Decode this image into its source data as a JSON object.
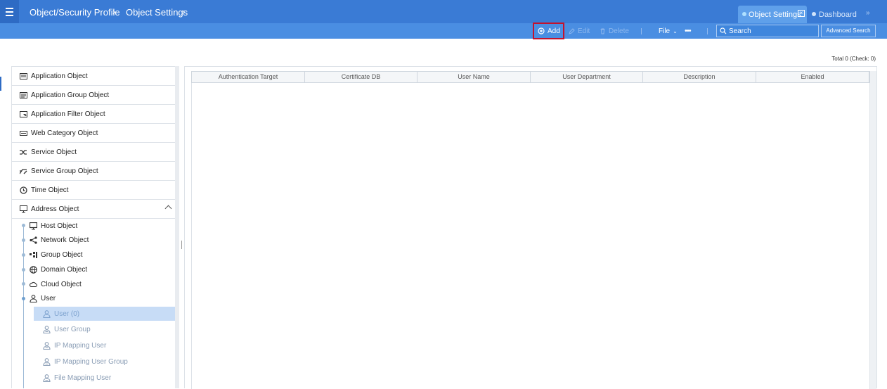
{
  "header": {
    "breadcrumb": [
      "Object/Security Profile",
      "Object Settings"
    ],
    "tabs": [
      {
        "label": "Object Settings",
        "active": true
      },
      {
        "label": "Dashboard",
        "active": false
      }
    ],
    "colors": {
      "header_bg": "#3a7bd5",
      "toolbar_bg": "#4a8ee2",
      "highlight_border": "#c4122d"
    }
  },
  "toolbar": {
    "add": "Add",
    "edit": "Edit",
    "delete": "Delete",
    "file": "File",
    "more": "•••",
    "search_placeholder": "Search",
    "advanced_search": "Advanced Search"
  },
  "summary": {
    "total": "Total 0 (Check: 0)"
  },
  "sidebar": {
    "items": [
      {
        "label": "Application Object",
        "icon": "application-icon"
      },
      {
        "label": "Application Group Object",
        "icon": "application-group-icon"
      },
      {
        "label": "Application Filter Object",
        "icon": "application-filter-icon"
      },
      {
        "label": "Web Category Object",
        "icon": "web-category-icon"
      },
      {
        "label": "Service Object",
        "icon": "shuffle-icon"
      },
      {
        "label": "Service Group Object",
        "icon": "service-group-icon"
      },
      {
        "label": "Time Object",
        "icon": "clock-icon"
      },
      {
        "label": "Address Object",
        "icon": "monitor-icon",
        "expanded": true
      }
    ],
    "address_children": [
      {
        "label": "Host Object",
        "icon": "monitor-icon"
      },
      {
        "label": "Network Object",
        "icon": "network-icon"
      },
      {
        "label": "Group Object",
        "icon": "group-icon"
      },
      {
        "label": "Domain Object",
        "icon": "globe-icon"
      },
      {
        "label": "Cloud Object",
        "icon": "cloud-icon"
      },
      {
        "label": "User",
        "icon": "user-icon"
      }
    ],
    "user_children": [
      {
        "label": "User (0)",
        "icon": "user-icon",
        "selected": true
      },
      {
        "label": "User Group",
        "icon": "user-group-icon"
      },
      {
        "label": "IP Mapping User",
        "icon": "user-group-icon"
      },
      {
        "label": "IP Mapping User Group",
        "icon": "user-group-icon"
      },
      {
        "label": "File Mapping User",
        "icon": "user-group-icon"
      }
    ]
  },
  "grid": {
    "columns": [
      "Authentication Target",
      "Certificate DB",
      "User Name",
      "User Department",
      "Description",
      "Enabled"
    ],
    "rows": []
  }
}
